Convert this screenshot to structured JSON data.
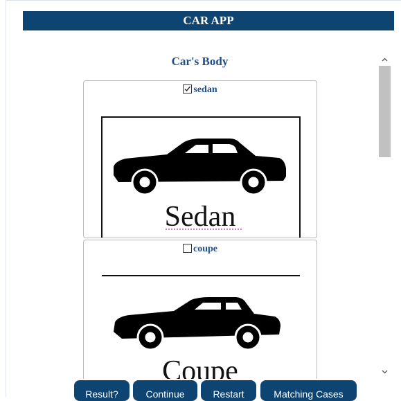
{
  "app": {
    "title": "CAR APP"
  },
  "section": {
    "title": "Car's Body"
  },
  "options": [
    {
      "label": "sedan",
      "checked": true,
      "image_caption": "Sedan"
    },
    {
      "label": "coupe",
      "checked": false,
      "image_caption": "Coupe"
    }
  ],
  "buttons": {
    "result": "Result?",
    "continue": "Continue",
    "restart": "Restart",
    "matching": "Matching Cases"
  },
  "colors": {
    "header_bg": "#0d4472",
    "accent_text": "#1f4e8a",
    "button_bg": "#0d4472"
  },
  "icons": {
    "scroll_up": "chevron-up-icon",
    "scroll_down": "chevron-down-icon"
  }
}
